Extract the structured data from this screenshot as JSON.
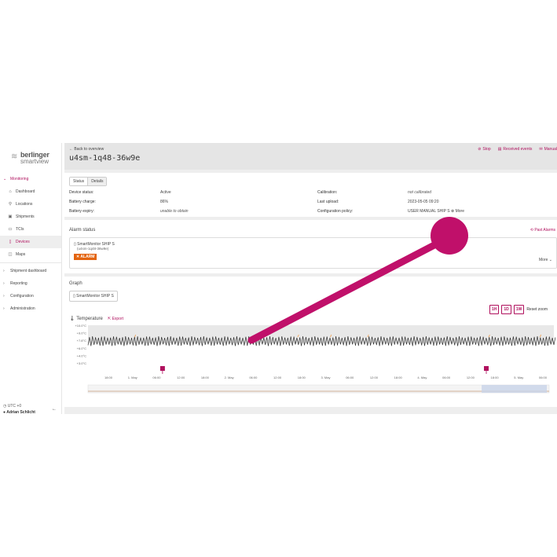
{
  "sidebar": {
    "logo_text": "berlinger",
    "logo_sub": "smartview",
    "items": [
      {
        "label": "Monitoring",
        "icon": "chevron-down-icon",
        "level": "top",
        "open": true
      },
      {
        "label": "Dashboard",
        "icon": "home-icon",
        "level": "sub"
      },
      {
        "label": "Locations",
        "icon": "pin-icon",
        "level": "sub"
      },
      {
        "label": "Shipments",
        "icon": "shipment-icon",
        "level": "sub"
      },
      {
        "label": "TCIs",
        "icon": "tag-icon",
        "level": "sub"
      },
      {
        "label": "Devices",
        "icon": "device-icon",
        "level": "sub",
        "active": true
      },
      {
        "label": "Maps",
        "icon": "map-icon",
        "level": "sub"
      },
      {
        "label": "Shipment dashboard",
        "icon": "chevron-right-icon",
        "level": "top"
      },
      {
        "label": "Reporting",
        "icon": "chevron-right-icon",
        "level": "top"
      },
      {
        "label": "Configuration",
        "icon": "chevron-right-icon",
        "level": "top"
      },
      {
        "label": "Administration",
        "icon": "chevron-right-icon",
        "level": "top"
      }
    ],
    "timezone": "UTC +0",
    "user": "Adrian Schlicht"
  },
  "header": {
    "back_label": "Back to overview",
    "title": "u4sm-1q48-36w9e",
    "actions": [
      {
        "label": "Stop",
        "icon": "stop-icon"
      },
      {
        "label": "Received events",
        "icon": "events-icon"
      },
      {
        "label": "Manual",
        "icon": "mail-icon"
      }
    ]
  },
  "status": {
    "tabs": [
      "Status",
      "Details"
    ],
    "device_status_label": "Device status:",
    "device_status_value": "Active",
    "battery_charge_label": "Battery charge:",
    "battery_charge_value": "86%",
    "battery_expiry_label": "Battery expiry:",
    "battery_expiry_value": "unable to obtain",
    "calibration_label": "Calibration:",
    "calibration_value": "not calibrated",
    "last_upload_label": "Last upload:",
    "last_upload_value": "2023-05-05 09:20",
    "config_policy_label": "Configuration policy:",
    "config_policy_value": "USER MANUAL SHIP S",
    "more_label": "More"
  },
  "alarm": {
    "section_title": "Alarm status",
    "past_alarms": "Past Alarms",
    "device_name": "SmartMonitor SHIP S",
    "device_id": "(u4sm-1q48-36w9e)",
    "badge": "ALARM",
    "more_label": "More"
  },
  "graph": {
    "section_title": "Graph",
    "device_button": "SmartMonitor SHIP S",
    "zoom_buttons": [
      "1H",
      "1D",
      "1W"
    ],
    "reset_zoom": "Reset zoom",
    "temperature_title": "Temperature",
    "export_label": "Export"
  },
  "colors": {
    "accent": "#b0115e",
    "alarm": "#e3640f",
    "line": "#333333",
    "excursion": "#f0a050",
    "alarm_band": "#e8e8e8"
  },
  "chart_data": {
    "type": "line",
    "title": "Temperature",
    "xlabel": "",
    "ylabel": "",
    "yticks": [
      "+10.0°C",
      "+9.0°C",
      "+7.8°C",
      "+6.0°C",
      "+4.0°C",
      "+3.0°C"
    ],
    "xticks": [
      "18:00",
      "1. May",
      "06:00",
      "12:00",
      "18:00",
      "2. May",
      "06:00",
      "12:00",
      "18:00",
      "3. May",
      "06:00",
      "12:00",
      "18:00",
      "4. May",
      "06:00",
      "12:00",
      "18:00",
      "5. May",
      "06:00"
    ],
    "ylim": [
      3.0,
      10.0
    ],
    "series": [
      {
        "pattern": "periodic oscillation",
        "min": 6.3,
        "max": 7.8,
        "cycles": 155
      }
    ],
    "markers": [
      {
        "position": "06:00 1. May",
        "icon": "calibration-marker-icon"
      },
      {
        "position": "18:00 4. May",
        "icon": "calibration-marker-icon"
      }
    ]
  }
}
